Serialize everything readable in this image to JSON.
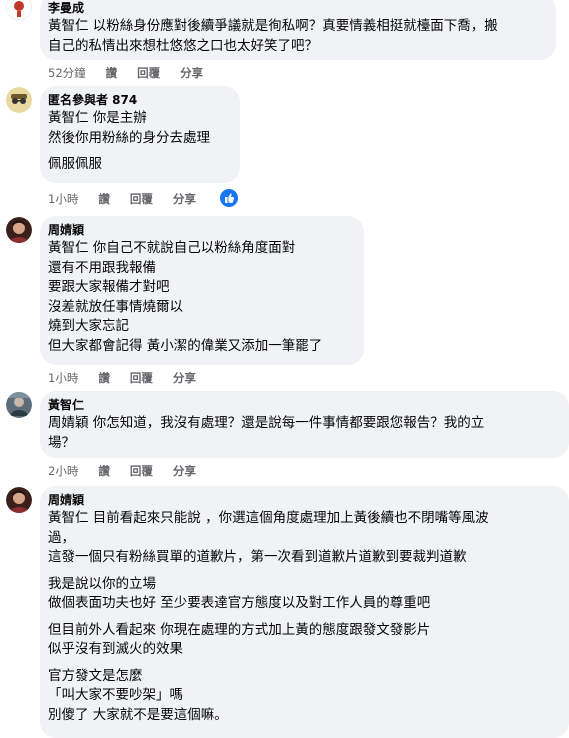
{
  "comments": [
    {
      "author": "李曼成",
      "lines": [
        [
          "黃智仁",
          " 以粉絲身份應對後續爭議就是徇私啊？真要情義相挺就檯面下喬，搬"
        ],
        [
          "",
          "自己的私情出來想杜悠悠之口也太好笑了吧？"
        ]
      ],
      "time": "52分鐘",
      "like": "讚",
      "reply": "回覆",
      "share": "分享"
    },
    {
      "author": "匿名參與者 874",
      "lines": [
        [
          "黃智仁",
          " 你是主辦"
        ],
        [
          "",
          "然後你用粉絲的身分去處理"
        ],
        [
          "",
          ""
        ],
        [
          "",
          "佩服佩服"
        ]
      ],
      "time": "1小時",
      "like": "讚",
      "reply": "回覆",
      "share": "分享",
      "reaction": "like-icon"
    },
    {
      "author": "周婧穎",
      "lines": [
        [
          "黃智仁",
          " 你自己不就說自己以粉絲角度面對"
        ],
        [
          "",
          "還有不用跟我報備"
        ],
        [
          "",
          "要跟大家報備才對吧"
        ],
        [
          "",
          "沒差就放任事情燒爾以"
        ],
        [
          "",
          "燒到大家忘記"
        ],
        [
          "",
          "但大家都會記得 黃小潔的偉業又添加一筆罷了"
        ]
      ],
      "time": "1小時",
      "like": "讚",
      "reply": "回覆",
      "share": "分享"
    },
    {
      "author": "黃智仁",
      "lines": [
        [
          "周婧穎",
          " 你怎知道，我沒有處理？還是說每一件事情都要跟您報告？我的立"
        ],
        [
          "",
          "場？"
        ]
      ],
      "time": "2小時",
      "like": "讚",
      "reply": "回覆",
      "share": "分享"
    },
    {
      "author": "周婧穎",
      "lines": [
        [
          "黃智仁",
          " 目前看起來只能說 ，你選這個角度處理加上黃後續也不閉嘴等風波"
        ],
        [
          "",
          "過，"
        ],
        [
          "",
          "這發一個只有粉絲買單的道歉片，第一次看到道歉片道歉到要裁判道歉"
        ],
        [
          "",
          ""
        ],
        [
          "",
          "我是說以你的立場"
        ],
        [
          "",
          "做個表面功夫也好 至少要表達官方態度以及對工作人員的尊重吧"
        ],
        [
          "",
          ""
        ],
        [
          "",
          "但目前外人看起來 你現在處理的方式加上黃的態度跟發文發影片"
        ],
        [
          "",
          "似乎沒有到滅火的效果"
        ],
        [
          "",
          ""
        ],
        [
          "",
          "官方發文是怎麼"
        ],
        [
          "",
          "「叫大家不要吵架」嗎"
        ],
        [
          "",
          "別傻了 大家就不是要這個嘛。"
        ]
      ]
    }
  ]
}
